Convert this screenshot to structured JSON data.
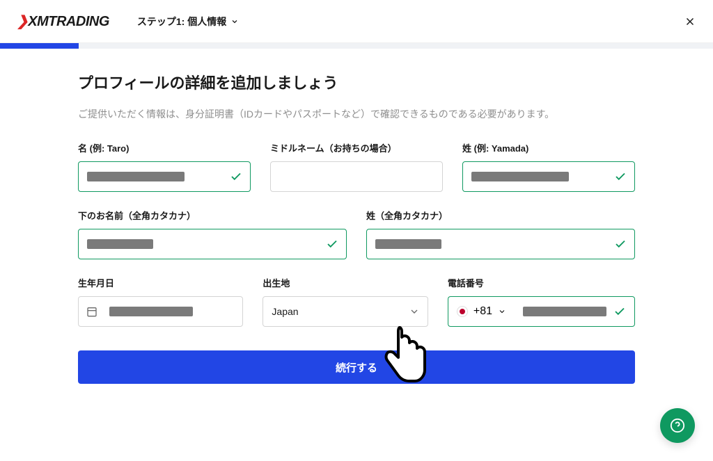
{
  "header": {
    "logo_prefix": "❯",
    "logo_text": "XMTRADING",
    "step_label": "ステップ1: 個人情報"
  },
  "page": {
    "title": "プロフィールの詳細を追加しましょう",
    "description": "ご提供いただく情報は、身分証明書（IDカードやパスポートなど）で確認できるものである必要があります。"
  },
  "fields": {
    "first_name": {
      "label": "名 (例: Taro)"
    },
    "middle_name": {
      "label": "ミドルネーム（お持ちの場合）"
    },
    "last_name": {
      "label": "姓 (例: Yamada)"
    },
    "kana_first": {
      "label": "下のお名前（全角カタカナ）"
    },
    "kana_last": {
      "label": "姓（全角カタカナ）"
    },
    "dob": {
      "label": "生年月日"
    },
    "birthplace": {
      "label": "出生地",
      "value": "Japan"
    },
    "phone": {
      "label": "電話番号",
      "dial_code": "+81"
    }
  },
  "submit_label": "続行する"
}
